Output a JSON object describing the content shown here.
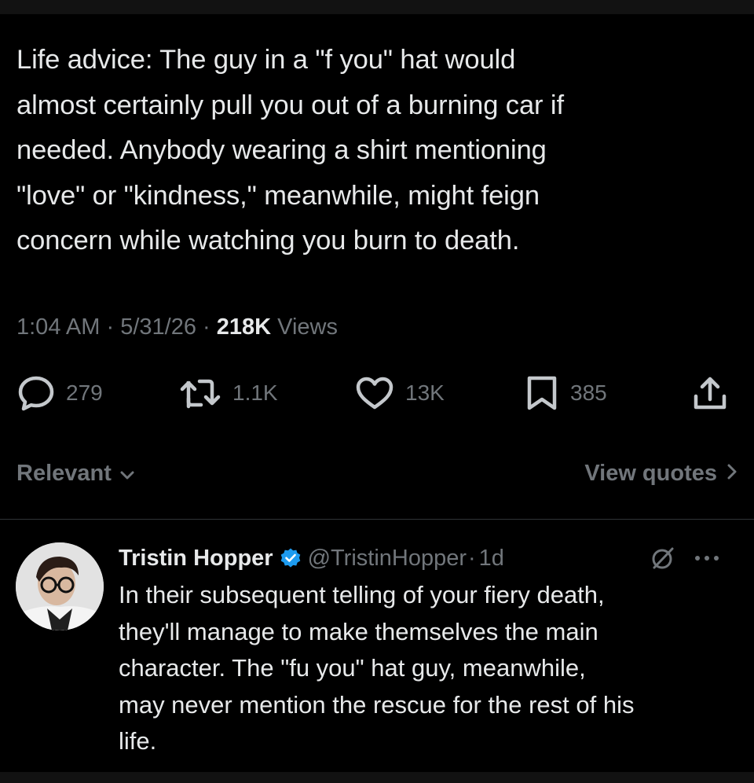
{
  "tweet": {
    "text": "Life advice: The guy in a \"f        you\" hat would\nalmost certainly pull you out of a burning car if\nneeded. Anybody wearing a shirt mentioning\n\"love\" or \"kindness,\" meanwhile, might feign\nconcern while watching you burn to death.",
    "time": "1:04 AM",
    "separator": "·",
    "date": "5/31/26",
    "views_count": "218K",
    "views_label": "Views"
  },
  "actions": {
    "replies": "279",
    "reposts": "1.1K",
    "likes": "13K",
    "bookmarks": "385",
    "icons": [
      "reply-icon",
      "repost-icon",
      "like-icon",
      "bookmark-icon",
      "share-icon"
    ]
  },
  "replies_section": {
    "sort_label": "Relevant",
    "view_quotes_label": "View quotes"
  },
  "reply": {
    "name": "Tristin Hopper",
    "handle": "@TristinHopper",
    "separator": "·",
    "age": "1d",
    "text": "In their subsequent telling of your fiery death,\nthey'll manage to make themselves the main\ncharacter. The \"fu       you\" hat guy, meanwhile,\nmay never mention the rescue for the rest of his\nlife."
  },
  "colors": {
    "background": "#000000",
    "text_primary": "#e7e9ea",
    "text_secondary": "#71767b",
    "verified_blue": "#1d9bf0",
    "divider": "#2f3336"
  }
}
